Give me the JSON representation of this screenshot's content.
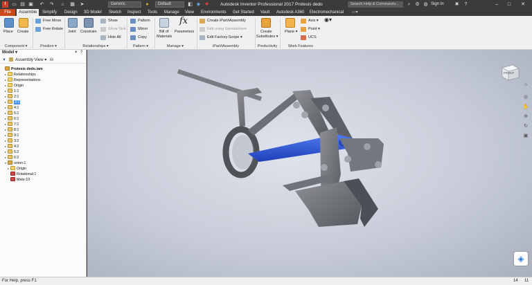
{
  "titlebar": {
    "app_logo": "I",
    "quick_access_icons": [
      "new-icon",
      "open-icon",
      "save-icon",
      "undo-icon",
      "redo-icon",
      "home-icon",
      "select-icon",
      "pointer-icon"
    ],
    "material_value": "Generic",
    "appearance_value": "Default",
    "title": "Autodesk Inventor Professional 2017   Protesis dedo",
    "search_placeholder": "Search Help & Commands...",
    "sign_in": "Sign In",
    "window_buttons": [
      "–",
      "□",
      "✕"
    ]
  },
  "tabs": [
    {
      "label": "File"
    },
    {
      "label": "Assemble"
    },
    {
      "label": "Simplify"
    },
    {
      "label": "Design"
    },
    {
      "label": "3D Model"
    },
    {
      "label": "Sketch"
    },
    {
      "label": "Inspect"
    },
    {
      "label": "Tools"
    },
    {
      "label": "Manage"
    },
    {
      "label": "View"
    },
    {
      "label": "Environments"
    },
    {
      "label": "Get Started"
    },
    {
      "label": "Vault"
    },
    {
      "label": "Autodesk A360"
    },
    {
      "label": "Electromechanical"
    }
  ],
  "ribbon": {
    "component": {
      "place": "Place",
      "create": "Create",
      "label": "Component ▾"
    },
    "position": {
      "free_move": "Free Move",
      "free_rotate": "Free Rotate",
      "label": "Position ▾"
    },
    "relationships": {
      "joint": "Joint",
      "constrain": "Constrain",
      "show": "Show",
      "show_sick": "Show Sick",
      "hide_all": "Hide All",
      "label": "Relationships ▾"
    },
    "pattern": {
      "pattern": "Pattern",
      "mirror": "Mirror",
      "copy": "Copy",
      "label": "Pattern ▾"
    },
    "manage": {
      "bom_line1": "Bill of",
      "bom_line2": "Materials",
      "parameters": "Parameters",
      "label": "Manage ▾"
    },
    "ipart": {
      "create": "Create iPart/iAssembly",
      "edit_spreadsheet": "Edit using Spreadsheet",
      "edit_factory": "Edit Factory Scope ▾",
      "label": "iPart/iAssembly"
    },
    "productivity": {
      "create_line1": "Create",
      "create_line2": "Substitutes ▾",
      "label": "Productivity"
    },
    "work_features": {
      "plane": "Plane ▾",
      "axis": "Axis ▾",
      "point": "Point ▾",
      "ucs": "UCS",
      "label": "Work Features"
    }
  },
  "browser": {
    "title": "Model ▾",
    "view_label": "Assembly View ▾",
    "add_icon": "+",
    "help_icon": "?",
    "items": [
      {
        "label": "Protesis dedo.iam",
        "icon": "asm",
        "arrow": "",
        "indent": 0,
        "bold": true
      },
      {
        "label": "Relationships",
        "icon": "folder",
        "arrow": "▸",
        "indent": 1
      },
      {
        "label": "Representations",
        "icon": "folder",
        "arrow": "▸",
        "indent": 1
      },
      {
        "label": "Origin",
        "icon": "folder",
        "arrow": "▸",
        "indent": 1
      },
      {
        "label": "1:1",
        "icon": "part",
        "arrow": "▸",
        "indent": 1
      },
      {
        "label": "2:1",
        "icon": "part",
        "arrow": "▸",
        "indent": 1
      },
      {
        "label": "3:1",
        "icon": "part",
        "arrow": "▸",
        "indent": 1,
        "selected": true
      },
      {
        "label": "4:1",
        "icon": "part",
        "arrow": "▸",
        "indent": 1
      },
      {
        "label": "5:1",
        "icon": "part",
        "arrow": "▸",
        "indent": 1
      },
      {
        "label": "6:1",
        "icon": "part",
        "arrow": "▸",
        "indent": 1
      },
      {
        "label": "7:1",
        "icon": "part",
        "arrow": "▸",
        "indent": 1
      },
      {
        "label": "8:1",
        "icon": "part",
        "arrow": "▸",
        "indent": 1
      },
      {
        "label": "9:1",
        "icon": "part",
        "arrow": "▸",
        "indent": 1
      },
      {
        "label": "3:2",
        "icon": "part",
        "arrow": "▸",
        "indent": 1
      },
      {
        "label": "4:2",
        "icon": "part",
        "arrow": "▸",
        "indent": 1
      },
      {
        "label": "5:2",
        "icon": "part",
        "arrow": "▸",
        "indent": 1
      },
      {
        "label": "6:2",
        "icon": "part",
        "arrow": "▸",
        "indent": 1
      },
      {
        "label": "union:1",
        "icon": "asm",
        "arrow": "▾",
        "indent": 1
      },
      {
        "label": "Origin",
        "icon": "folder",
        "arrow": "▸",
        "indent": 2
      },
      {
        "label": "Rotational:1",
        "icon": "red",
        "arrow": "",
        "indent": 2
      },
      {
        "label": "Mate:10",
        "icon": "red",
        "arrow": "",
        "indent": 2
      }
    ]
  },
  "viewport": {
    "viewcube_label": "FRONT",
    "nav_icons": [
      "home-icon",
      "steering-wheel-icon",
      "pan-icon",
      "zoom-icon",
      "orbit-icon",
      "look-at-icon"
    ],
    "badge_icon": "cube-badge-icon"
  },
  "status": {
    "help_text": "For Help, press F1",
    "count_a": "14",
    "count_b": "11"
  }
}
